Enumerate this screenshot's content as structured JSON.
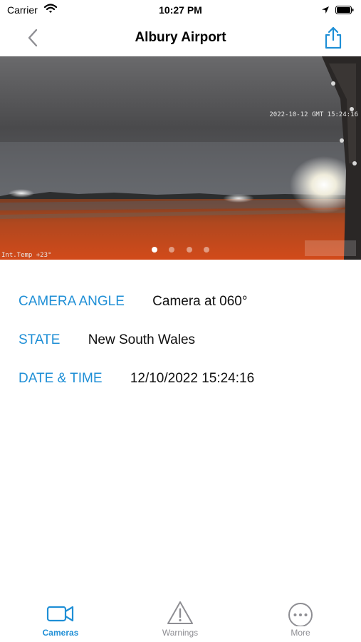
{
  "status_bar": {
    "carrier": "Carrier",
    "time": "10:27 PM"
  },
  "nav": {
    "title": "Albury Airport"
  },
  "camera": {
    "overlay_timestamp": "2022-10-12 GMT 15:24:16",
    "overlay_temp": "Int.Temp +23°",
    "page_count": 4,
    "active_page": 1
  },
  "details": [
    {
      "label": "CAMERA ANGLE",
      "value": "Camera at 060°"
    },
    {
      "label": "STATE",
      "value": "New South Wales"
    },
    {
      "label": "DATE & TIME",
      "value": "12/10/2022 15:24:16"
    }
  ],
  "tabs": [
    {
      "label": "Cameras",
      "icon": "video-camera-icon",
      "active": true
    },
    {
      "label": "Warnings",
      "icon": "warning-triangle-icon",
      "active": false
    },
    {
      "label": "More",
      "icon": "more-ellipsis-icon",
      "active": false
    }
  ],
  "colors": {
    "accent": "#1f8fd6",
    "inactive": "#8e8e93"
  }
}
